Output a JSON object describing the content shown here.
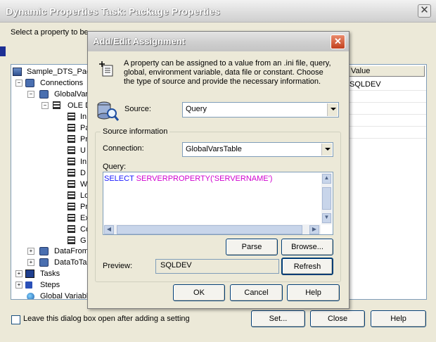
{
  "parent_window": {
    "title": "Dynamic Properties Task: Package Properties",
    "instruction": "Select a property to be",
    "grid_header": "Value",
    "grid_value": "SQLDEV",
    "leave_open_label": "Leave this dialog box open after adding a setting",
    "leave_open_checked": false,
    "buttons": {
      "set": "Set...",
      "close": "Close",
      "help": "Help"
    },
    "tree": {
      "root": "Sample_DTS_Pac",
      "connections": "Connections",
      "globalvars": "GlobalVar",
      "oledb": "OLE D",
      "leaf_labels": [
        "In",
        "Pa",
        "Pr",
        "U",
        "In",
        "D",
        "W",
        "Lo",
        "Pr",
        "Ex",
        "Co",
        "G"
      ],
      "datafrom": "DataFrom",
      "datato": "DataToTa",
      "tasks": "Tasks",
      "steps": "Steps",
      "globalvariables": "Global Variabl"
    }
  },
  "dialog": {
    "title": "Add/Edit Assignment",
    "description": "A property can be assigned to a value from an .ini file, query, global, environment variable, data file or constant.  Choose the type of source and provide the necessary information.",
    "source_label": "Source:",
    "source_value": "Query",
    "group_label": "Source information",
    "connection_label": "Connection:",
    "connection_value": "GlobalVarsTable",
    "query_label": "Query:",
    "query": {
      "select": "SELECT",
      "function": "SERVERPROPERTY",
      "args": "('SERVERNAME')"
    },
    "parse_label": "Parse",
    "browse_label": "Browse...",
    "preview_label": "Preview:",
    "preview_value": "SQLDEV",
    "refresh_label": "Refresh",
    "ok_label": "OK",
    "cancel_label": "Cancel",
    "help_label": "Help"
  },
  "icons": {
    "close": "close-icon",
    "assignment": "assignment-icon",
    "source": "database-query-icon"
  },
  "colors": {
    "window_bg": "#ece9d8",
    "dialog_close": "#c2401e",
    "keyword": "#1a1aff",
    "function": "#d000d0"
  }
}
